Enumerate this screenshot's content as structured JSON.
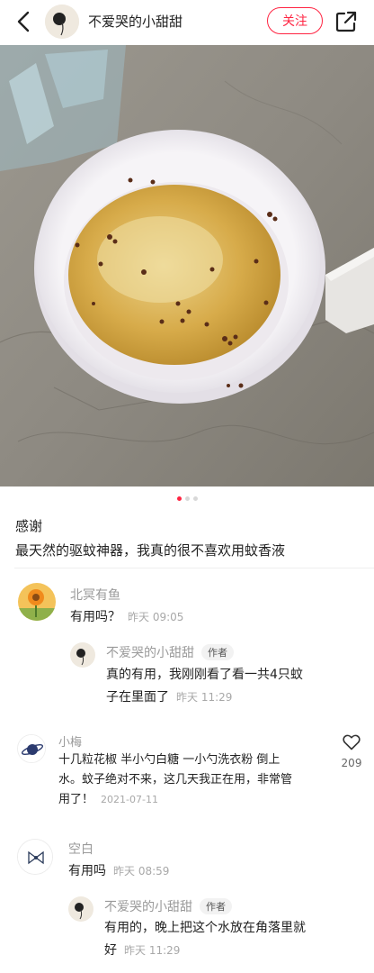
{
  "header": {
    "author_name": "不爱哭的小甜甜",
    "follow_label": "关注",
    "back_icon": "chevron-left-icon",
    "share_icon": "share-icon"
  },
  "carousel": {
    "total": 3,
    "active_index": 0
  },
  "note": {
    "title": "感谢",
    "body": "最天然的驱蚊神器，我真的很不喜欢用蚊香液"
  },
  "comments": [
    {
      "name": "北冥有鱼",
      "text": "有用吗？",
      "time": "昨天 09:05",
      "reply": {
        "name": "不爱哭的小甜甜",
        "tag": "作者",
        "text_line1": "真的有用，我刚刚看了看一共4只蚊",
        "text_line2": "子在里面了",
        "time": "昨天 11:29"
      }
    },
    {
      "name": "小梅",
      "text_line1": "十几粒花椒 半小勺白糖 一小勺洗衣粉 倒上",
      "text_line2": "水。蚊子绝对不来，这几天我正在用，非常管",
      "text_line3": "用了！",
      "time": "2021-07-11",
      "likes": "209"
    },
    {
      "name": "空白",
      "text": "有用吗",
      "time": "昨天 08:59",
      "reply": {
        "name": "不爱哭的小甜甜",
        "tag": "作者",
        "text_line1": "有用的，晚上把这个水放在角落里就",
        "text_line2": "好",
        "time": "昨天 11:29"
      }
    }
  ],
  "colors": {
    "accent": "#ff2442",
    "secondary_text": "#9a9a9a"
  }
}
